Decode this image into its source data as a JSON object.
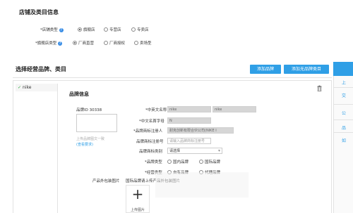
{
  "store": {
    "title": "店铺及类目信息",
    "store_type_label": "*店铺类型",
    "store_type_options": [
      "旗舰店",
      "专营店",
      "专卖店"
    ],
    "store_type_selected": 0,
    "flagship_type_label": "*旗舰店类型",
    "flagship_type_options": [
      "厂商直营",
      "厂商授权",
      "卖场型"
    ],
    "flagship_type_selected": 0
  },
  "brand_section": {
    "title": "选择经营品牌、类目",
    "add_brand_button": "添加品牌",
    "add_no_brand_button": "添加无品牌类目",
    "brand_list_item": "nike",
    "check_mark": "✓"
  },
  "brand_info": {
    "title": "品牌信息",
    "brand_id_label": "品牌ID 30338",
    "logo_hint": "上传品牌图文一致",
    "logo_link": "(查看要求)",
    "fields": {
      "cn_name_label": "*中英文名称",
      "cn_name_value1": "nike",
      "cn_name_value2": "nike",
      "initial_label": "*中文名首字母",
      "initial_value": "N",
      "owner_label": "*品牌商标注册人",
      "owner_value": "耐克创新有限合伙公司(NIKE I",
      "reg_no_label": "品牌商标注册号",
      "reg_no_placeholder": "请输入品牌商标注册号",
      "reg_cat_label": "品牌商标类别",
      "reg_cat_value": "请选择",
      "brand_type_label": "*品牌类型",
      "brand_type_options": [
        "国内品牌",
        "国际品牌"
      ],
      "op_type_label": "*经营类型",
      "op_type_options": [
        "自有品牌",
        "代理品牌"
      ]
    },
    "package_label": "产品外包装图片",
    "package_hint": "国际品牌请上传产品外包装图片",
    "upload_plus": "+",
    "upload_label": "上传图片"
  },
  "side_panel": {
    "items": [
      "上",
      "交",
      "公",
      "品",
      "如"
    ]
  },
  "colors": {
    "accent": "#2f9fe6",
    "field_bg": "#d6d6d6"
  }
}
